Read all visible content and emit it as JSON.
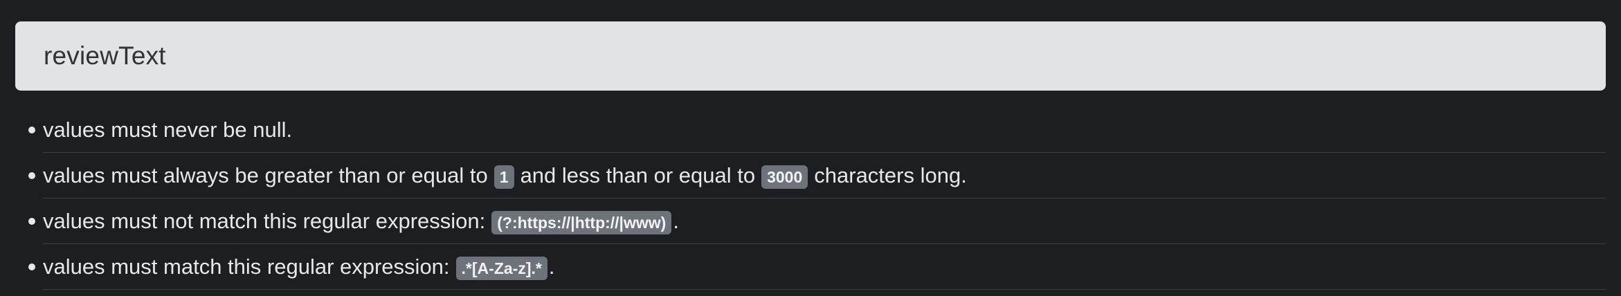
{
  "header": {
    "title": "reviewText"
  },
  "rules": [
    {
      "text": "values must never be null."
    },
    {
      "prefix": "values must always be greater than or equal to",
      "min": "1",
      "middle": "and less than or equal to",
      "max": "3000",
      "suffix": "characters long."
    },
    {
      "prefix": "values must not match this regular expression:",
      "pattern": "(?:https://|http://|www)",
      "suffix": "."
    },
    {
      "prefix": "values must match this regular expression:",
      "pattern": ".*[A-Za-z].*",
      "suffix": "."
    }
  ],
  "colors": {
    "background": "#1c1e22",
    "header_background": "#e2e3e5",
    "code_background": "#6e737b"
  }
}
